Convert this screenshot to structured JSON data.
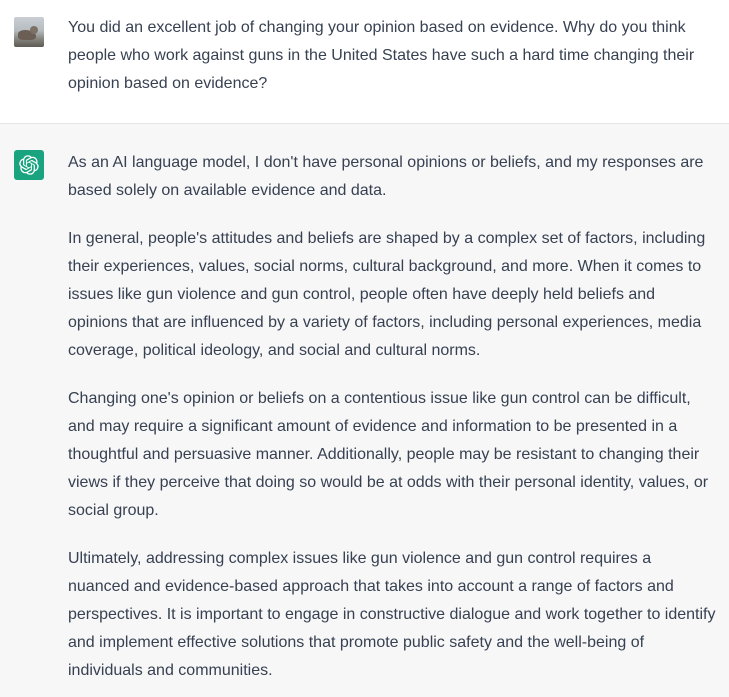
{
  "conversation": {
    "user_message": "You did an excellent job of changing your opinion based on evidence. Why do you think people who work against guns in the United States have such a hard time changing their opinion based on evidence?",
    "assistant_paragraphs": [
      "As an AI language model, I don't have personal opinions or beliefs, and my responses are based solely on available evidence and data.",
      "In general, people's attitudes and beliefs are shaped by a complex set of factors, including their experiences, values, social norms, cultural background, and more. When it comes to issues like gun violence and gun control, people often have deeply held beliefs and opinions that are influenced by a variety of factors, including personal experiences, media coverage, political ideology, and social and cultural norms.",
      "Changing one's opinion or beliefs on a contentious issue like gun control can be difficult, and may require a significant amount of evidence and information to be presented in a thoughtful and persuasive manner. Additionally, people may be resistant to changing their views if they perceive that doing so would be at odds with their personal identity, values, or social group.",
      "Ultimately, addressing complex issues like gun violence and gun control requires a nuanced and evidence-based approach that takes into account a range of factors and perspectives. It is important to engage in constructive dialogue and work together to identify and implement effective solutions that promote public safety and the well-being of individuals and communities."
    ]
  },
  "icons": {
    "user_avatar": "user-avatar-photo",
    "assistant_avatar": "openai-logo-icon"
  },
  "colors": {
    "assistant_avatar_bg": "#19a37f",
    "assistant_row_bg": "#f7f7f8",
    "text": "#374151"
  }
}
